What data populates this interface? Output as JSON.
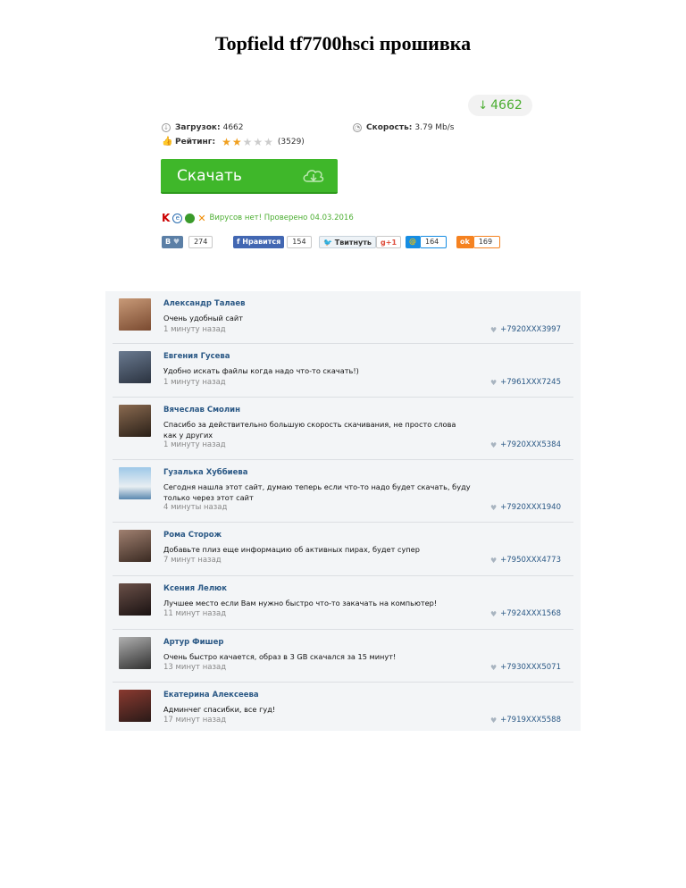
{
  "title": "Topfield tf7700hsci прошивка",
  "download_badge": "4662",
  "stats": {
    "downloads_label": "Загрузок:",
    "downloads_value": "4662",
    "speed_label": "Скорость:",
    "speed_value": "3.79 Mb/s",
    "rating_label": "Рейтинг:",
    "rating_stars": 2,
    "rating_count": "(3529)"
  },
  "download_button": "Скачать",
  "antivirus_text": "Вирусов нет! Проверено 04.03.2016",
  "social": {
    "vk_label": "В",
    "vk_count": "274",
    "fb_label": "Нравится",
    "fb_count": "154",
    "tw_label": "Твитнуть",
    "gplus_label": "+1",
    "mail_count": "164",
    "ok_count": "169"
  },
  "comments": [
    {
      "name": "Александр Талаев",
      "text": "Очень удобный сайт",
      "time": "1 минуту назад",
      "phone": "+7920XXX3997"
    },
    {
      "name": "Евгения Гусева",
      "text": "Удобно искать файлы когда надо что-то скачать!)",
      "time": "1 минуту назад",
      "phone": "+7961XXX7245"
    },
    {
      "name": "Вячеслав Смолин",
      "text": "Спасибо за действительно большую скорость скачивания, не просто слова как у других",
      "time": "1 минуту назад",
      "phone": "+7920XXX5384"
    },
    {
      "name": "Гузалька Хуббиева",
      "text": "Сегодня нашла этот сайт, думаю теперь если что-то надо будет скачать, буду только через этот сайт",
      "time": "4 минуты назад",
      "phone": "+7920XXX1940"
    },
    {
      "name": "Рома Сторож",
      "text": "Добавьте плиз еще информацию об активных пирах, будет супер",
      "time": "7 минут назад",
      "phone": "+7950XXX4773"
    },
    {
      "name": "Ксения Лелюк",
      "text": "Лучшее место если Вам нужно быстро что-то закачать на компьютер!",
      "time": "11 минут назад",
      "phone": "+7924XXX1568"
    },
    {
      "name": "Артур Фишер",
      "text": "Очень быстро качается, образ в 3 GB скачался за 15 минут!",
      "time": "13 минут назад",
      "phone": "+7930XXX5071"
    },
    {
      "name": "Екатерина Алексеева",
      "text": "Админчег спасибки, все гуд!",
      "time": "17 минут назад",
      "phone": "+7919XXX5588"
    }
  ]
}
